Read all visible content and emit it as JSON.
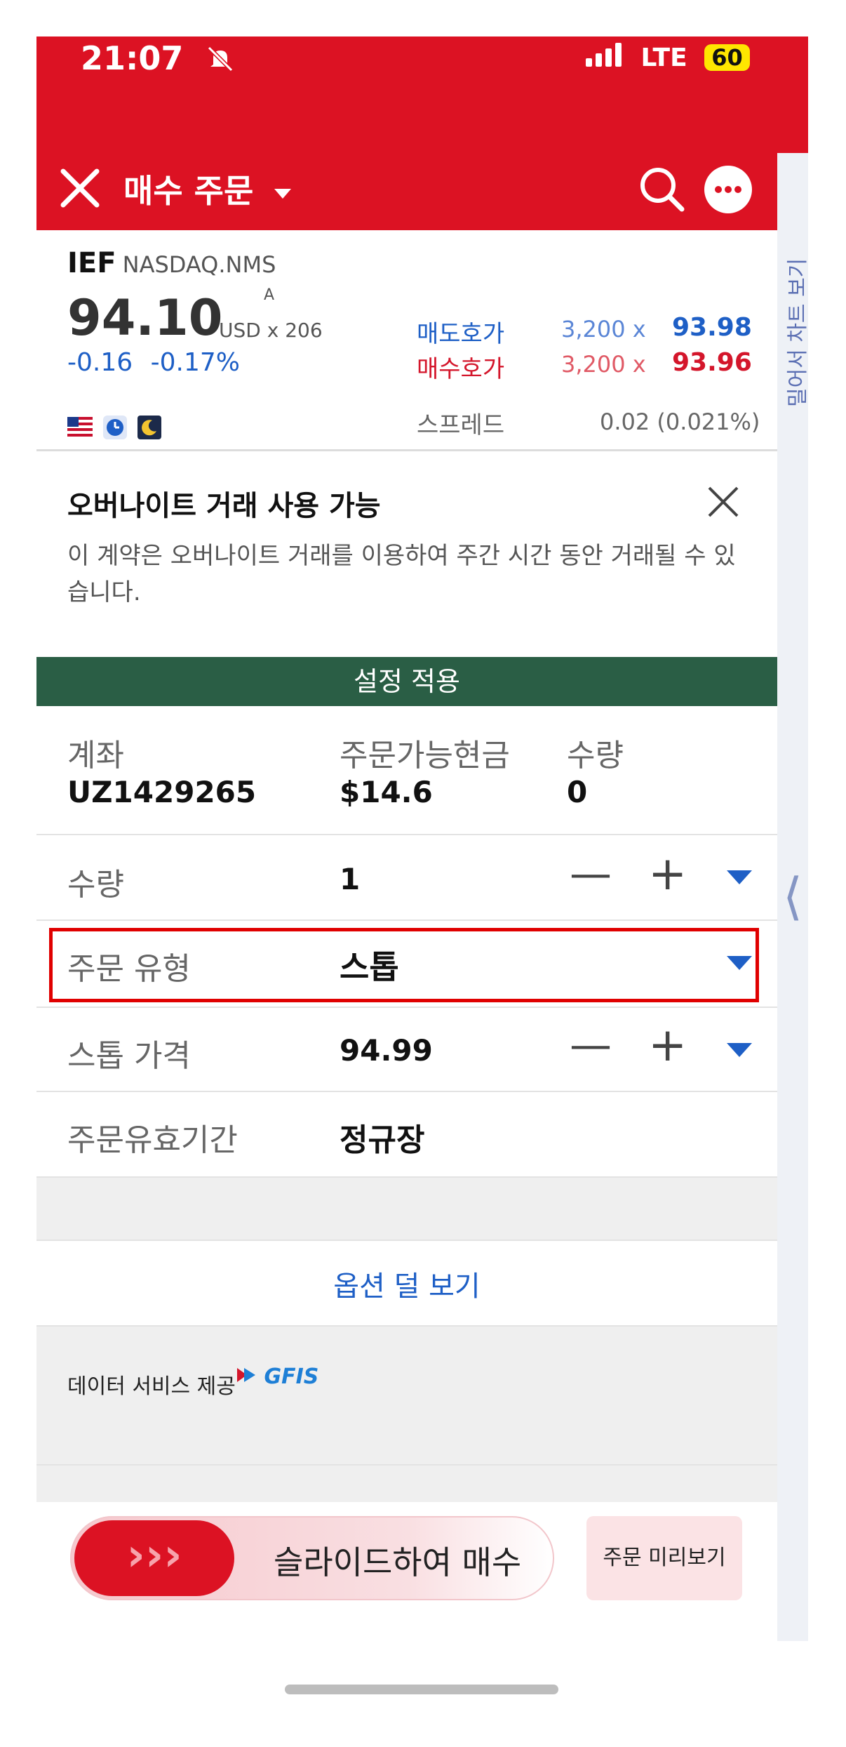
{
  "status_bar": {
    "time": "21:07",
    "network": "LTE",
    "battery": "60"
  },
  "header": {
    "title": "매수 주문"
  },
  "quote": {
    "symbol": "IEF",
    "exchange": "NASDAQ.NMS",
    "price": "94.10",
    "price_marker": "A",
    "currency_size": "USD x 206",
    "change": "-0.16",
    "change_pct": "-0.17%",
    "ask_label": "매도호가",
    "ask_size": "3,200 x",
    "ask_price": "93.98",
    "bid_label": "매수호가",
    "bid_size": "3,200 x",
    "bid_price": "93.96",
    "spread_label": "스프레드",
    "spread_value": "0.02 (0.021%)"
  },
  "notice": {
    "title": "오버나이트 거래 사용 가능",
    "body_line1": "이 계약은 오버나이트 거래를 이용하여 주간 시간 동안 거래될 수 있",
    "body_line2": "습니다."
  },
  "apply_banner": "설정 적용",
  "account_summary": {
    "account_label": "계좌",
    "account_value": "UZ1429265",
    "cash_label": "주문가능현금",
    "cash_value": "$14.6",
    "qty_label": "수량",
    "qty_value": "0"
  },
  "form": {
    "quantity_label": "수량",
    "quantity_value": "1",
    "order_type_label": "주문 유형",
    "order_type_value": "스톱",
    "stop_price_label": "스톱 가격",
    "stop_price_value": "94.99",
    "tif_label": "주문유효기간",
    "tif_value": "정규장",
    "minus": "—",
    "plus": "+"
  },
  "less_options": "옵션 덜 보기",
  "data_provider": {
    "label": "데이터 서비스 제공",
    "logo_text": "GFIS"
  },
  "side_panel": {
    "label": "밀어서 차트 보기",
    "chevron": "⟨"
  },
  "footer": {
    "slide_label": "슬라이드하여 매수",
    "slide_arrows": "›››",
    "preview_label": "주문 미리보기"
  },
  "colors": {
    "brand_red": "#dc1223",
    "apply_green": "#2a5e45",
    "ask_blue": "#1e5fc6",
    "bid_red": "#d4162b",
    "highlight": "#e00000"
  }
}
